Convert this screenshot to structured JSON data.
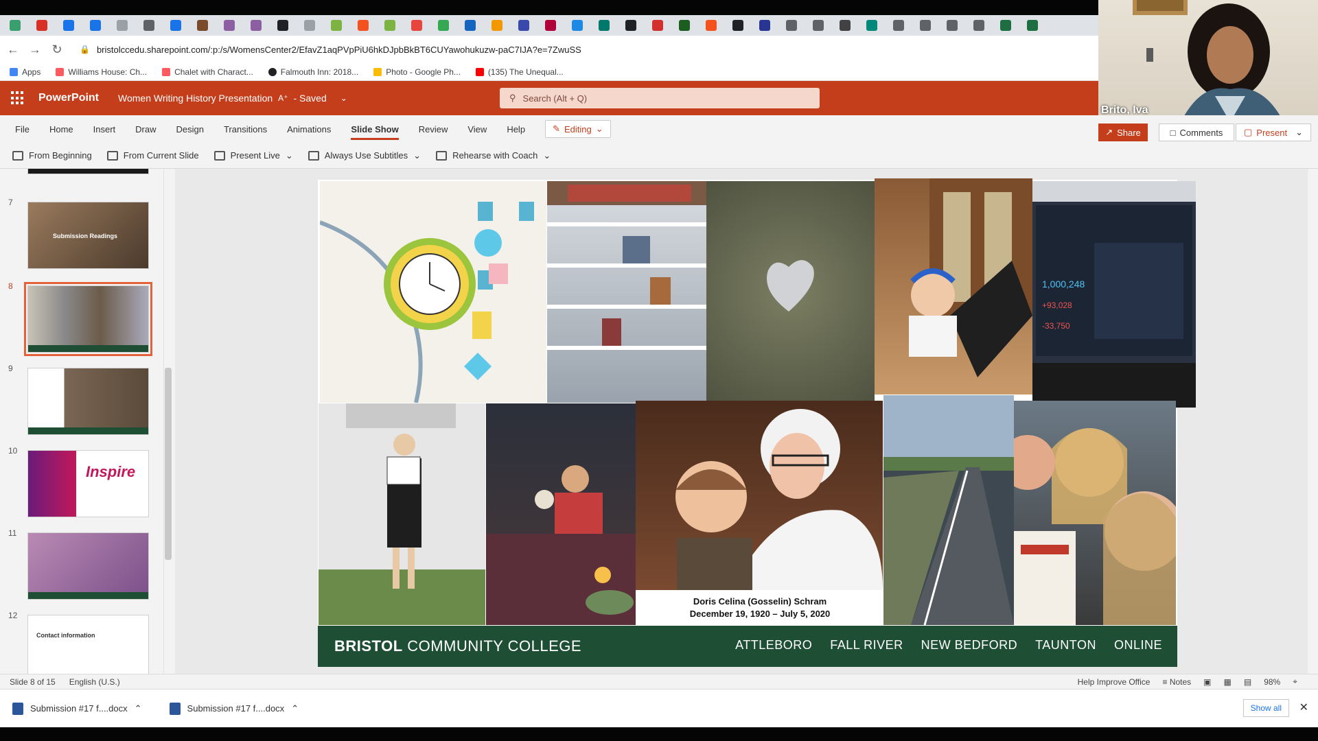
{
  "browser": {
    "url": "bristolccedu.sharepoint.com/:p:/s/WomensCenter2/EfavZ1aqPVpPiU6hkDJpbBkBT6CUYawohukuzw-paC7IJA?e=7ZwuSS",
    "bookmarks": [
      "Apps",
      "Williams House: Ch...",
      "Chalet with Charact...",
      "Falmouth Inn: 2018...",
      "Photo - Google Ph...",
      "(135) The Unequal..."
    ]
  },
  "app": {
    "name": "PowerPoint",
    "doc_title": "Women Writing History Presentation",
    "saved_status": "- Saved",
    "search_placeholder": "Search (Alt + Q)"
  },
  "ribbon": {
    "tabs": [
      "File",
      "Home",
      "Insert",
      "Draw",
      "Design",
      "Transitions",
      "Animations",
      "Slide Show",
      "Review",
      "View",
      "Help"
    ],
    "active_tab": "Slide Show",
    "editing_label": "Editing",
    "share_label": "Share",
    "comments_label": "Comments",
    "present_label": "Present",
    "commands": [
      "From Beginning",
      "From Current Slide",
      "Present Live",
      "Always Use Subtitles",
      "Rehearse with Coach"
    ]
  },
  "thumbnails": [
    {
      "num": "7",
      "text": "Submission Readings"
    },
    {
      "num": "8",
      "text": ""
    },
    {
      "num": "9",
      "text": ""
    },
    {
      "num": "10",
      "text": "Inspire"
    },
    {
      "num": "11",
      "text": ""
    },
    {
      "num": "12",
      "text": "Contact information"
    }
  ],
  "slide": {
    "caption_line1": "Doris Celina (Gosselin) Schram",
    "caption_line2": "December 19, 1920 – July 5, 2020",
    "college_bold": "BRISTOL",
    "college_rest": "COMMUNITY COLLEGE",
    "campuses": [
      "ATTLEBORO",
      "FALL RIVER",
      "NEW BEDFORD",
      "TAUNTON",
      "ONLINE"
    ]
  },
  "status": {
    "slide_count": "Slide 8 of 15",
    "language": "English (U.S.)",
    "help": "Help Improve Office",
    "notes": "Notes",
    "zoom": "98%"
  },
  "downloads": {
    "items": [
      "Submission #17 f....docx",
      "Submission #17 f....docx"
    ],
    "show_all": "Show all"
  },
  "webcam": {
    "name": "Brito, Iva"
  },
  "colors": {
    "powerpoint_orange": "#c43e1c",
    "college_green": "#1e4f35"
  }
}
